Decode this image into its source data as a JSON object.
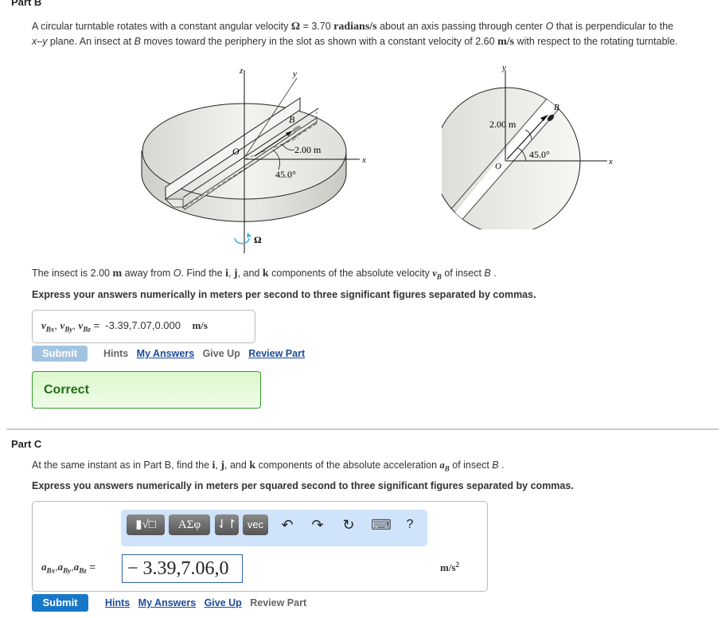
{
  "partB": {
    "title": "Part B",
    "intro_1a": "A circular turntable rotates with a constant angular velocity ",
    "omega_symbol": "Ω",
    "intro_1b": " = 3.70 ",
    "intro_unit1": "radians/s",
    "intro_1c": " about an axis passing through center ",
    "O": "O",
    "intro_1d": " that is perpendicular to the",
    "intro_2a": "x–y",
    "intro_2b": " plane. An insect at ",
    "B": "B",
    "intro_2c": " moves toward the periphery in the slot as shown with a constant velocity of 2.60 ",
    "intro_unit2": "m/s",
    "intro_2d": " with respect to the rotating turntable.",
    "figure": {
      "left": {
        "z_label": "z",
        "y_label": "y",
        "x_label": "x",
        "O_label": "O",
        "B_label": "B",
        "distance_label": "2.00 m",
        "angle_label": "45.0°",
        "omega_label": "Ω"
      },
      "right": {
        "y_label": "y",
        "x_label": "x",
        "O_label": "O",
        "B_label": "B",
        "distance_label": "2.00 m",
        "angle_label": "45.0°"
      }
    },
    "question_a": "The insect is 2.00 ",
    "question_unit": "m",
    "question_b": " away from ",
    "question_O": "O",
    "question_c": ". Find the ",
    "i": "i",
    "sep1": ", ",
    "j": "j",
    "sep2": ", and ",
    "k": "k",
    "question_d": " components of the absolute velocity ",
    "vB": "v",
    "vB_sub": "B",
    "question_e": " of insect ",
    "question_B": "B",
    "question_f": " .",
    "instruction": "Express your answers numerically in meters per second to three significant figures separated by commas.",
    "answer_label_v": "v",
    "answer_subs": [
      "Bx",
      "By",
      "Bz"
    ],
    "answer_eq": "=",
    "answer_value": "-3.39,7.07,0.000",
    "answer_unit": "m/s",
    "actions": {
      "submit": "Submit",
      "hints": "Hints",
      "my_answers": "My Answers",
      "give_up": "Give Up",
      "review_part": "Review Part"
    },
    "feedback": "Correct"
  },
  "partC": {
    "title": "Part C",
    "question_a": "At the same instant as in Part B, find the ",
    "i": "i",
    "sep1": ", ",
    "j": "j",
    "sep2": ", and ",
    "k": "k",
    "question_b": " components of the absolute acceleration ",
    "aB": "a",
    "aB_sub": "B",
    "question_c": " of insect ",
    "question_B": "B",
    "question_d": " .",
    "instruction": "Express you answers numerically in meters per squared second to three significant figures separated by commas.",
    "toolbar": {
      "templates": "▮√□",
      "greek": "ΑΣφ",
      "arrows": "⇃↾",
      "vec": "vec",
      "undo_icon": "↶",
      "redo_icon": "↷",
      "reset_icon": "↻",
      "keyboard_icon": "⌨",
      "help": "?"
    },
    "answer_label_a": "a",
    "answer_subs": [
      "Bx",
      "By",
      "Bz"
    ],
    "answer_eq": "=",
    "answer_value": "− 3.39,7.06,0",
    "answer_unit": "m/s",
    "answer_unit_exp": "2",
    "actions": {
      "submit": "Submit",
      "hints": "Hints",
      "my_answers": "My Answers",
      "give_up": "Give Up",
      "review_part": "Review Part"
    }
  },
  "colors": {
    "submit_disabled": "#a3c4e0",
    "submit_active": "#1878c8",
    "link": "#1a4b99",
    "correct_border": "#3a9a2a",
    "correct_text": "#1f6e18",
    "toolbar_bg": "#cfe3fa"
  }
}
